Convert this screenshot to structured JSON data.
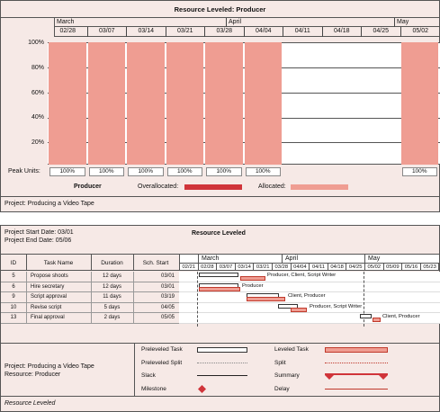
{
  "histogram": {
    "title": "Resource Leveled: Producer",
    "months": [
      {
        "label": "March"
      },
      {
        "label": "April"
      },
      {
        "label": "May"
      }
    ],
    "weeks": [
      "02/28",
      "03/07",
      "03/14",
      "03/21",
      "03/28",
      "04/04",
      "04/11",
      "04/18",
      "04/25",
      "05/02"
    ],
    "y_labels": [
      "100%",
      "80%",
      "60%",
      "40%",
      "20%"
    ],
    "peak_units_label": "Peak Units:",
    "peak_units": [
      "100%",
      "100%",
      "100%",
      "100%",
      "100%",
      "100%",
      "",
      "",
      "",
      "100%"
    ],
    "allocation_fraction": [
      1,
      1,
      1,
      1,
      1,
      1,
      0,
      0,
      0,
      1
    ],
    "legend": {
      "resource": "Producer",
      "overallocated": "Overallocated:",
      "allocated": "Allocated:",
      "overallocated_color": "#d0343a",
      "allocated_color": "#ef9d92"
    },
    "footer": "Project: Producing a Video Tape"
  },
  "gantt": {
    "project_start": "Project Start Date: 03/01",
    "project_end": "Project End Date: 05/06",
    "title": "Resource Leveled",
    "columns": {
      "id": "ID",
      "name": "Task Name",
      "duration": "Duration",
      "start": "Sch. Start"
    },
    "months": [
      "March",
      "April",
      "May"
    ],
    "weeks": [
      "02/21",
      "02/28",
      "03/07",
      "03/14",
      "03/21",
      "03/28",
      "04/04",
      "04/11",
      "04/18",
      "04/25",
      "05/02",
      "05/09",
      "05/16",
      "05/23"
    ],
    "tasks": [
      {
        "id": "5",
        "name": "Propose shoots",
        "duration": "12 days",
        "start": "03/01",
        "resources": "Producer, Client, Script Writer"
      },
      {
        "id": "6",
        "name": "Hire secretary",
        "duration": "12 days",
        "start": "03/01",
        "resources": "Producer"
      },
      {
        "id": "9",
        "name": "Script approval",
        "duration": "11 days",
        "start": "03/19",
        "resources": "Client, Producer"
      },
      {
        "id": "10",
        "name": "Revise script",
        "duration": "5 days",
        "start": "04/05",
        "resources": "Producer, Script Writer"
      },
      {
        "id": "13",
        "name": "Final approval",
        "duration": "2 days",
        "start": "05/05",
        "resources": "Client, Producer"
      }
    ],
    "project_info": [
      "Project: Producing a Video Tape",
      "Resource: Producer"
    ],
    "legend": {
      "preleveled_task": "Preleveled Task",
      "leveled_task": "Leveled Task",
      "preleveled_split": "Preleveled Split",
      "split": "Split",
      "slack": "Slack",
      "summary": "Summary",
      "milestone": "Milestone",
      "delay": "Delay"
    },
    "footer": "Resource Leveled"
  }
}
